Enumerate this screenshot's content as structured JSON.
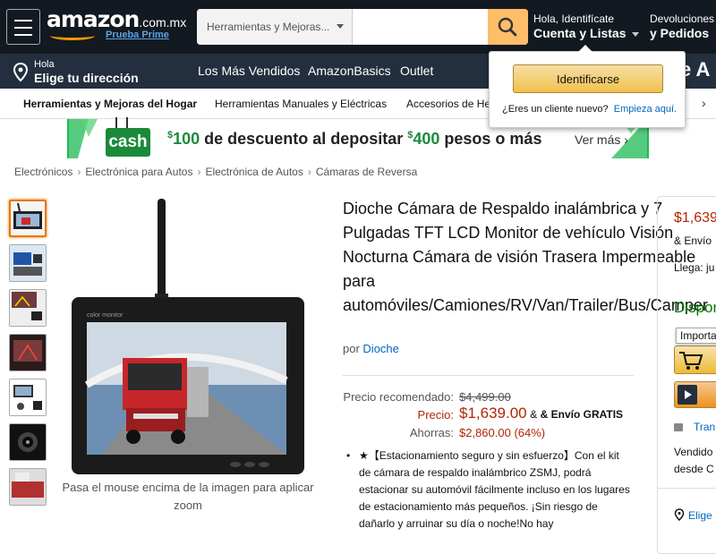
{
  "header": {
    "logo": "amazon",
    "logo_tld": ".com.mx",
    "prime_link": "Prueba Prime",
    "search": {
      "category": "Herramientas y Mejoras...",
      "placeholder": ""
    },
    "account": {
      "greeting": "Hola, Identifícate",
      "label": "Cuenta y Listas"
    },
    "returns": {
      "line1": "Devoluciones",
      "line2": "y Pedidos"
    }
  },
  "subnav": {
    "address_hello": "Hola",
    "address_label": "Elige tu dirección",
    "links": [
      "Los Más Vendidos",
      "AmazonBasics",
      "Outlet"
    ],
    "right_fragment": "e A"
  },
  "departments": [
    "Herramientas y Mejoras del Hogar",
    "Herramientas Manuales y Eléctricas",
    "Accesorios de He"
  ],
  "signin_flyout": {
    "button": "Identificarse",
    "question": "¿Eres un cliente nuevo?",
    "link": "Empieza aquí."
  },
  "banner": {
    "logo_text": "cash",
    "amount1": "100",
    "text1": " de descuento al depositar ",
    "amount2": "400",
    "text2": " pesos o más",
    "currency": "$",
    "more": "Ver más ›"
  },
  "breadcrumb": [
    "Electrónicos",
    "Electrónica para Autos",
    "Electrónica de Autos",
    "Cámaras de Reversa"
  ],
  "product": {
    "title": "Dioche Cámara de Respaldo inalámbrica y 7 Pulgadas TFT LCD Monitor de vehículo Visión Nocturna Cámara de visión Trasera Impermeable para automóviles/Camiones/RV/Van/Trailer/Bus/Camper",
    "by_label": "por",
    "brand": "Dioche",
    "monitor_brand": "color monitor",
    "zoom_hint": "Pasa el mouse encima de la imagen para aplicar zoom"
  },
  "pricing": {
    "list_label": "Precio recomendado:",
    "list_price": "$4,499.00",
    "price_label": "Precio:",
    "price": "$1,639.00",
    "shipping": "& Envío GRATIS",
    "save_label": "Ahorras:",
    "savings": "$2,860.00 (64%)"
  },
  "bullet": "★【Estacionamiento seguro y sin esfuerzo】Con el kit de cámara de respaldo inalámbrico ZSMJ, podrá estacionar su automóvil fácilmente incluso en los lugares de estacionamiento más pequeños. ¡Sin riesgo de dañarlo y arruinar su día o noche!No hay",
  "buybox": {
    "price": "$1,639",
    "shipping": "& Envío",
    "arrives": "Llega: ju",
    "availability": "Dispon",
    "import_label": "Importa",
    "secure": "Tran",
    "sold_by": "Vendido",
    "ships_from": "desde C",
    "address": "Elige"
  },
  "colors": {
    "header_bg": "#131921",
    "subnav_bg": "#232f3e",
    "accent": "#febd69",
    "price_red": "#b12704",
    "link_blue": "#0066c0",
    "in_stock_green": "#007600"
  }
}
